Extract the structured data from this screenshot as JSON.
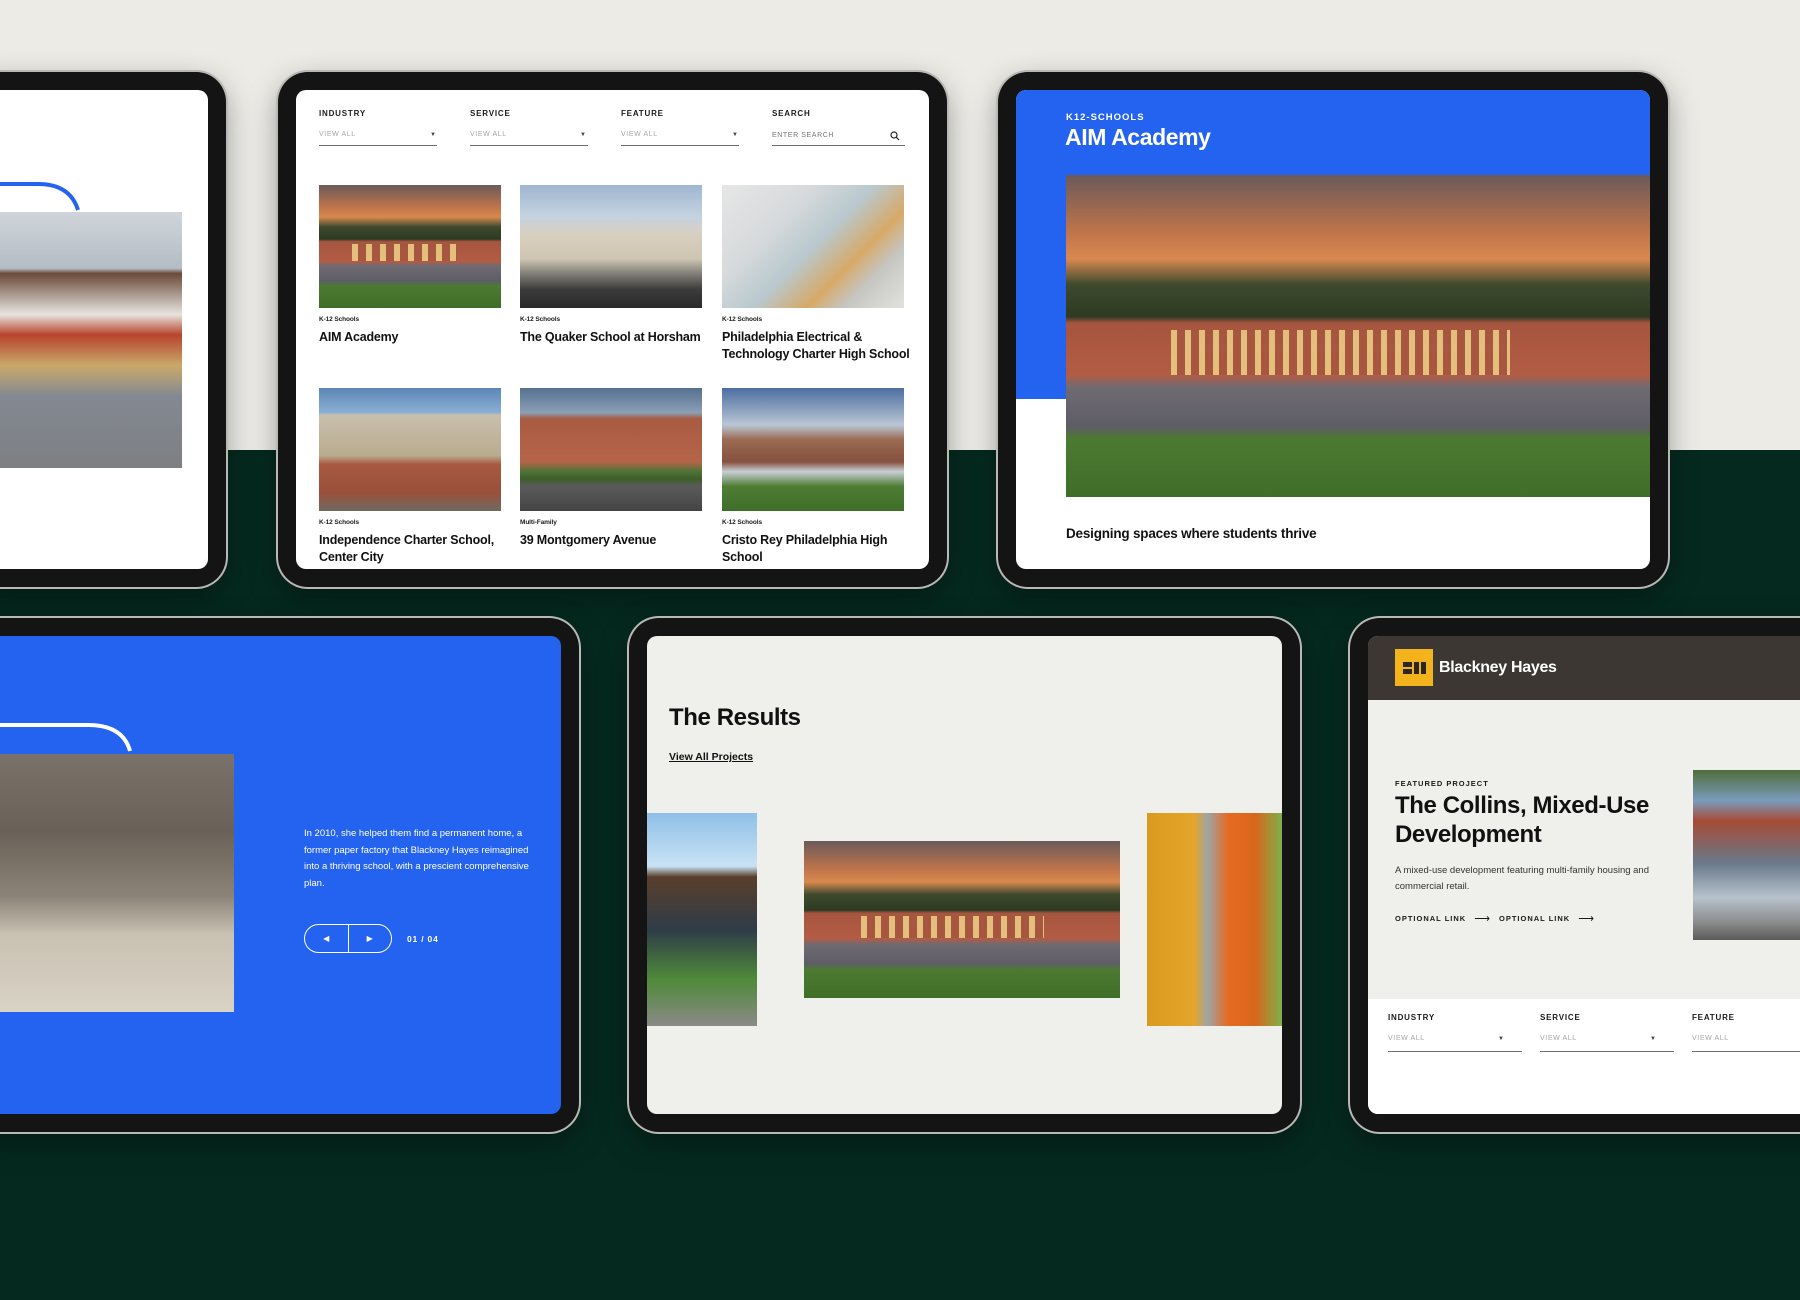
{
  "colors": {
    "brand_blue": "#2462f0",
    "dark_green_bg": "#05291f",
    "light_bg": "#ecebe6",
    "brand_yellow": "#f2b31c",
    "header_dark": "#3c3733"
  },
  "tablet_project_grid": {
    "filters": [
      {
        "label": "INDUSTRY",
        "value": "VIEW ALL",
        "icon": "chevron-down-icon"
      },
      {
        "label": "SERVICE",
        "value": "VIEW ALL",
        "icon": "chevron-down-icon"
      },
      {
        "label": "FEATURE",
        "value": "VIEW ALL",
        "icon": "chevron-down-icon"
      }
    ],
    "search": {
      "label": "SEARCH",
      "placeholder": "ENTER SEARCH",
      "icon": "search-icon"
    },
    "projects": [
      {
        "category": "K-12 Schools",
        "title": "AIM Academy"
      },
      {
        "category": "K-12 Schools",
        "title": "The Quaker School at Horsham"
      },
      {
        "category": "K-12 Schools",
        "title": "Philadelphia Electrical & Technology Charter High School"
      },
      {
        "category": "K-12 Schools",
        "title": "Independence Charter School, Center City"
      },
      {
        "category": "Multi-Family",
        "title": "39 Montgomery Avenue"
      },
      {
        "category": "K-12 Schools",
        "title": "Cristo Rey Philadelphia High School"
      }
    ]
  },
  "tablet_project_detail": {
    "eyebrow": "K12-SCHOOLS",
    "title": "AIM Academy",
    "tagline": "Designing spaces where students thrive"
  },
  "tablet_story_slider": {
    "body": "In 2010, she helped them find a permanent home, a former paper factory that Blackney Hayes reimagined into a thriving school, with a prescient comprehensive plan.",
    "prev_icon": "arrow-left-icon",
    "next_icon": "arrow-right-icon",
    "counter": "01 / 04"
  },
  "tablet_results": {
    "heading": "The Results",
    "link": "View All Projects"
  },
  "tablet_home": {
    "brand_name": "Blackney Hayes",
    "logo_icon": "bh-logo-icon",
    "eyebrow": "FEATURED PROJECT",
    "title": "The Collins, Mixed-Use Development",
    "description": "A mixed-use development featuring multi-family housing and commercial retail.",
    "links": [
      {
        "label": "OPTIONAL LINK",
        "icon": "arrow-right-icon"
      },
      {
        "label": "OPTIONAL LINK",
        "icon": "arrow-right-icon"
      }
    ],
    "filters": [
      {
        "label": "INDUSTRY",
        "value": "VIEW ALL"
      },
      {
        "label": "SERVICE",
        "value": "VIEW ALL"
      },
      {
        "label": "FEATURE",
        "value": "VIEW ALL"
      }
    ]
  }
}
